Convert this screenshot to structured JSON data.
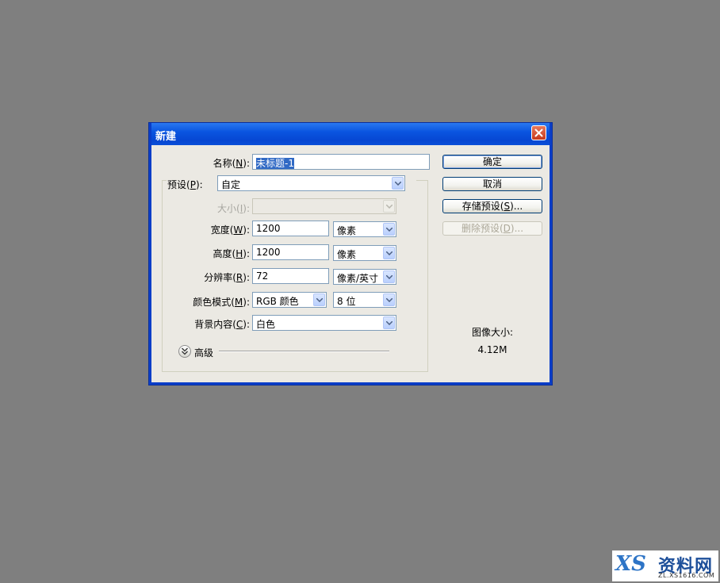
{
  "dialog": {
    "title": "新建",
    "name": {
      "label_pre": "名称(",
      "accel": "N",
      "label_post": "):",
      "value": "未标题-1"
    },
    "preset": {
      "label_pre": "预设(",
      "accel": "P",
      "label_post": "):",
      "value": "自定"
    },
    "size": {
      "label_pre": "大小(",
      "accel": "I",
      "label_post": "):",
      "value": ""
    },
    "width": {
      "label_pre": "宽度(",
      "accel": "W",
      "label_post": "):",
      "value": "1200",
      "unit": "像素"
    },
    "height": {
      "label_pre": "高度(",
      "accel": "H",
      "label_post": "):",
      "value": "1200",
      "unit": "像素"
    },
    "resolution": {
      "label_pre": "分辨率(",
      "accel": "R",
      "label_post": "):",
      "value": "72",
      "unit": "像素/英寸"
    },
    "color_mode": {
      "label_pre": "颜色模式(",
      "accel": "M",
      "label_post": "):",
      "value": "RGB 颜色",
      "depth": "8 位"
    },
    "background": {
      "label_pre": "背景内容(",
      "accel": "C",
      "label_post": "):",
      "value": "白色"
    },
    "advanced_label": "高级",
    "buttons": {
      "ok": "确定",
      "cancel": "取消",
      "save_preset_pre": "存储预设(",
      "save_preset_accel": "S",
      "save_preset_post": ")...",
      "delete_preset_pre": "删除预设(",
      "delete_preset_accel": "D",
      "delete_preset_post": ")..."
    },
    "image_size_label": "图像大小:",
    "image_size_value": "4.12M"
  },
  "watermark": {
    "logo_text": "XS",
    "cn_text": "资料网",
    "url_text": "ZL.XS1616.COM"
  },
  "colors": {
    "desktop": "#7f7f7f",
    "titlebar": "#0a55e0",
    "client": "#ebe9e3",
    "selection": "#316ac5"
  }
}
